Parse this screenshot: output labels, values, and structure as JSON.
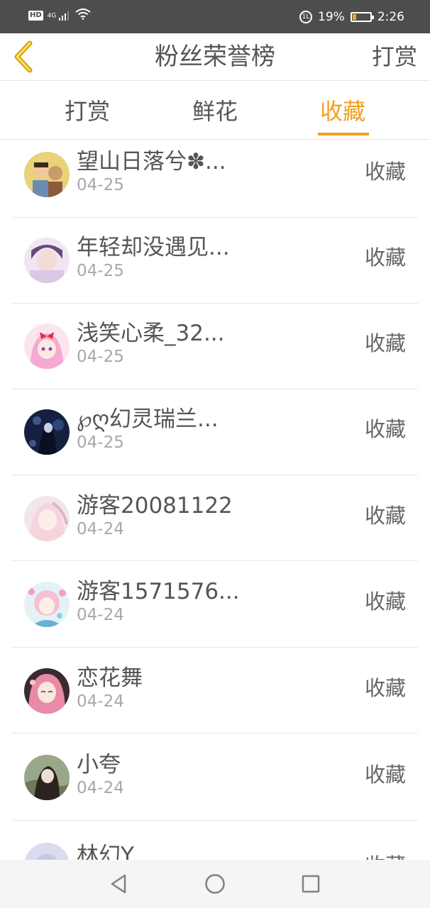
{
  "status_bar": {
    "network": "HD",
    "signal_type": "4G",
    "battery_percent": "19%",
    "time": "2:26"
  },
  "header": {
    "title": "粉丝荣誉榜",
    "right_action": "打赏"
  },
  "tabs": [
    {
      "label": "打赏",
      "active": false
    },
    {
      "label": "鲜花",
      "active": false
    },
    {
      "label": "收藏",
      "active": true
    }
  ],
  "fans": [
    {
      "name": "望山日落兮✽...",
      "date": "04-25",
      "action": "收藏"
    },
    {
      "name": "年轻却没遇见...",
      "date": "04-25",
      "action": "收藏"
    },
    {
      "name": "浅笑心柔_32...",
      "date": "04-25",
      "action": "收藏"
    },
    {
      "name": "℘ღ幻灵瑞兰...",
      "date": "04-25",
      "action": "收藏"
    },
    {
      "name": "游客20081122",
      "date": "04-24",
      "action": "收藏"
    },
    {
      "name": "游客1571576...",
      "date": "04-24",
      "action": "收藏"
    },
    {
      "name": "恋花舞",
      "date": "04-24",
      "action": "收藏"
    },
    {
      "name": "小夸",
      "date": "04-24",
      "action": "收藏"
    },
    {
      "name": "林幻Y",
      "date": "",
      "action": "收藏"
    }
  ],
  "colors": {
    "accent": "#f0a020",
    "status_bar": "#4d4d4d",
    "text": "#555555",
    "date": "#a8a8a8"
  }
}
